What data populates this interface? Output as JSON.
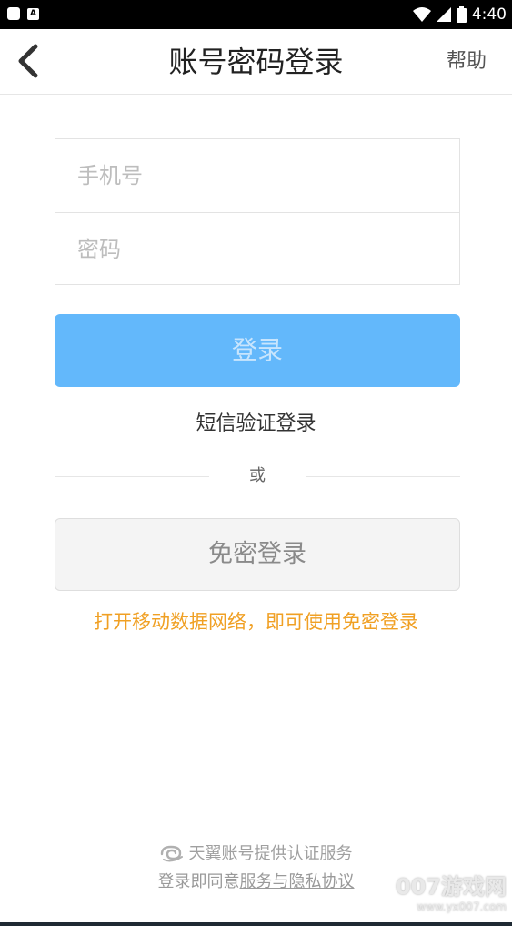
{
  "status_bar": {
    "time": "4:40",
    "left_icons": [
      "notification-icon",
      "app-a-icon"
    ],
    "right_icons": [
      "wifi-icon",
      "signal-icon",
      "battery-icon"
    ]
  },
  "header": {
    "back_icon": "chevron-left-icon",
    "title": "账号密码登录",
    "help_label": "帮助"
  },
  "form": {
    "phone_placeholder": "手机号",
    "phone_value": "",
    "password_placeholder": "密码",
    "password_value": ""
  },
  "login_button_label": "登录",
  "sms_login_link": "短信验证登录",
  "divider_text": "或",
  "free_login_button_label": "免密登录",
  "hint_text": "打开移动数据网络，即可使用免密登录",
  "footer": {
    "provider_text": "天翼账号提供认证服务",
    "agree_prefix": "登录即同意",
    "agree_link": "服务与隐私协议"
  },
  "watermark": {
    "main": "007游戏网",
    "sub": "www.yx007.com"
  },
  "colors": {
    "primary": "#63b8fb",
    "hint": "#f0a024"
  }
}
